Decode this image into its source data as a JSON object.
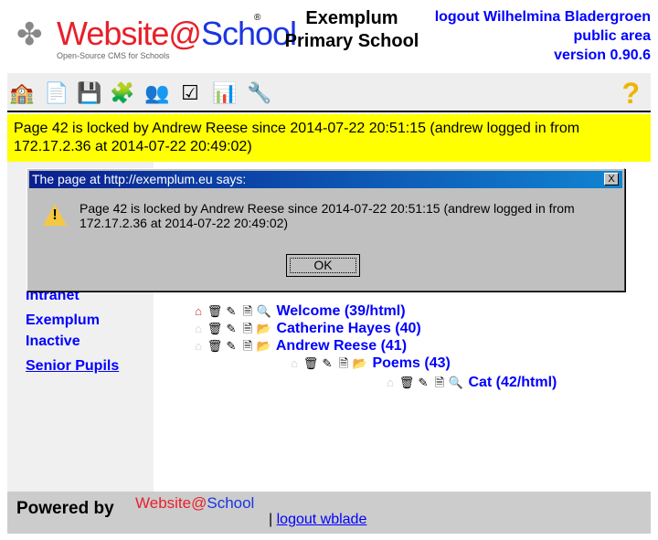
{
  "header": {
    "logo_text": "Website@School",
    "logo_sub": "Open-Source CMS for Schools",
    "school_line1": "Exemplum",
    "school_line2": "Primary School",
    "logout": "logout Wilhelmina Bladergroen",
    "public_area": "public area",
    "version": "version 0.90.6"
  },
  "toolbar": {
    "items": [
      "start",
      "page-manager",
      "file-manager",
      "modules",
      "account-manager",
      "configuration",
      "statistics",
      "tools"
    ],
    "help": "?"
  },
  "message": "Page 42 is locked by Andrew Reese since 2014-07-22 20:51:15 (andrew logged in from 172.17.2.36 at 2014-07-22 20:49:02)",
  "sidebar": {
    "items": [
      "Intranet",
      "Exemplum",
      "Inactive",
      "Senior Pupils"
    ]
  },
  "tree": [
    {
      "label": "Welcome (39/html)",
      "icon": "page"
    },
    {
      "label": "Catherine Hayes (40)",
      "icon": "folder"
    },
    {
      "label": "Andrew Reese (41)",
      "icon": "folder"
    },
    {
      "label": "Poems (43)",
      "icon": "folder"
    },
    {
      "label": "Cat (42/html)",
      "icon": "page"
    }
  ],
  "footer": {
    "powered_by": "Powered by",
    "logo_text": "Website@School",
    "separator": "|",
    "logout": "logout wblade"
  },
  "dialog": {
    "title": "The page at http://exemplum.eu says:",
    "close": "X",
    "text": "Page 42 is locked by Andrew Reese since 2014-07-22 20:51:15 (andrew logged in from 172.17.2.36 at 2014-07-22 20:49:02)",
    "ok": "OK"
  }
}
